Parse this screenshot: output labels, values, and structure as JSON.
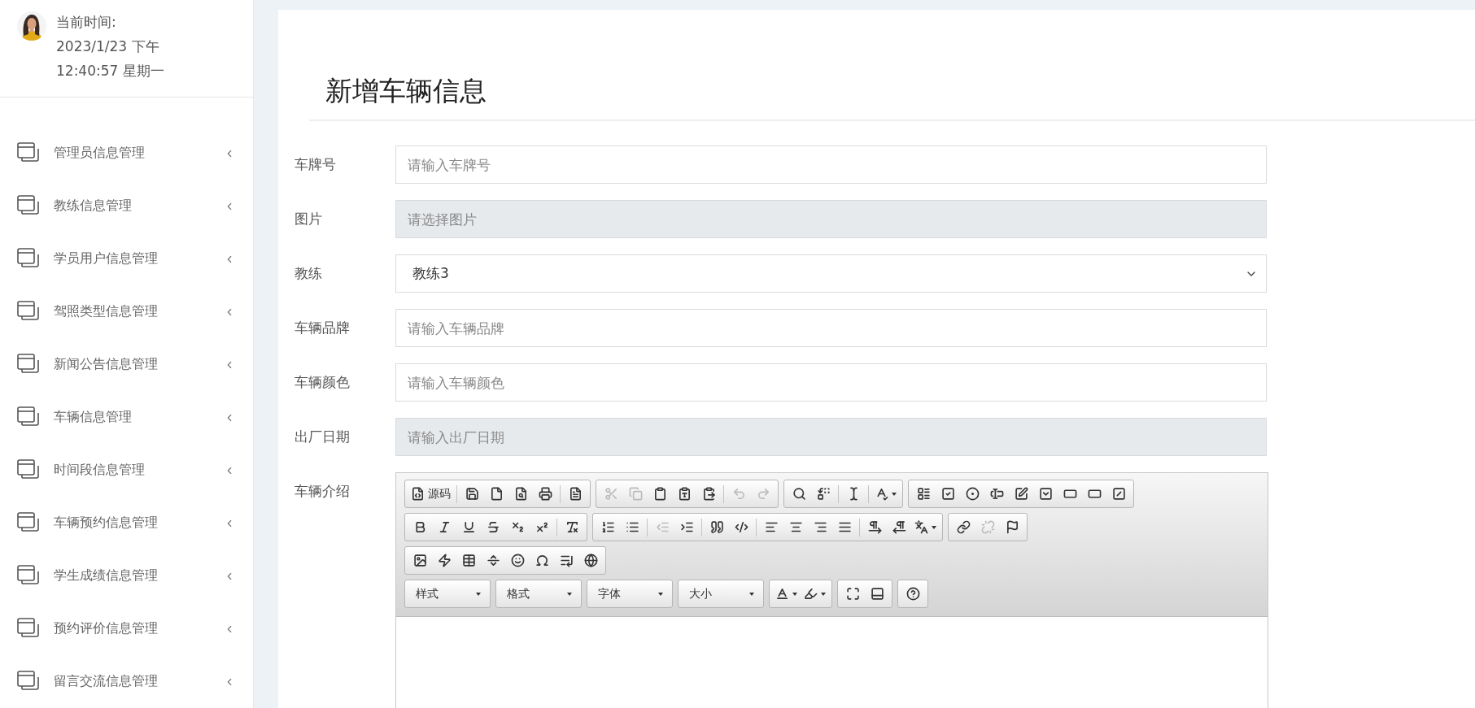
{
  "sidebar": {
    "time_label": "当前时间:",
    "date": "2023/1/23 下午",
    "time": "12:40:57 星期一",
    "items": [
      {
        "label": "管理员信息管理",
        "expanded": false
      },
      {
        "label": "教练信息管理",
        "expanded": false
      },
      {
        "label": "学员用户信息管理",
        "expanded": false
      },
      {
        "label": "驾照类型信息管理",
        "expanded": false
      },
      {
        "label": "新闻公告信息管理",
        "expanded": false
      },
      {
        "label": "车辆信息管理",
        "expanded": false
      },
      {
        "label": "时间段信息管理",
        "expanded": false
      },
      {
        "label": "车辆预约信息管理",
        "expanded": false
      },
      {
        "label": "学生成绩信息管理",
        "expanded": false
      },
      {
        "label": "预约评价信息管理",
        "expanded": false
      },
      {
        "label": "留言交流信息管理",
        "expanded": false
      }
    ]
  },
  "page_title": "新增车辆信息",
  "form": [
    {
      "kind": "input",
      "label": "车牌号",
      "placeholder": "请输入车牌号",
      "readonly": false
    },
    {
      "kind": "input",
      "label": "图片",
      "placeholder": "请选择图片",
      "readonly": true
    },
    {
      "kind": "select",
      "label": "教练",
      "value": "教练3"
    },
    {
      "kind": "input",
      "label": "车辆品牌",
      "placeholder": "请输入车辆品牌",
      "readonly": false
    },
    {
      "kind": "input",
      "label": "车辆颜色",
      "placeholder": "请输入车辆颜色",
      "readonly": false
    },
    {
      "kind": "input",
      "label": "出厂日期",
      "placeholder": "请输入出厂日期",
      "readonly": true
    },
    {
      "kind": "editor",
      "label": "车辆介绍"
    }
  ],
  "editor": {
    "toolbar": [
      [
        [
          {
            "kind": "button",
            "label": "源码",
            "disabled": false
          },
          {
            "kind": "separator"
          },
          {
            "kind": "button",
            "disabled": false
          },
          {
            "kind": "button",
            "disabled": false
          },
          {
            "kind": "button",
            "disabled": false
          },
          {
            "kind": "button",
            "disabled": false
          },
          {
            "kind": "separator"
          },
          {
            "kind": "button",
            "disabled": false
          }
        ],
        [
          {
            "kind": "button",
            "disabled": true
          },
          {
            "kind": "button",
            "disabled": true
          },
          {
            "kind": "button",
            "disabled": false
          },
          {
            "kind": "button",
            "disabled": false
          },
          {
            "kind": "button",
            "disabled": false
          },
          {
            "kind": "separator"
          },
          {
            "kind": "button",
            "disabled": true
          },
          {
            "kind": "button",
            "disabled": true
          }
        ],
        [
          {
            "kind": "button",
            "disabled": false
          },
          {
            "kind": "button",
            "disabled": false
          },
          {
            "kind": "separator"
          },
          {
            "kind": "button",
            "disabled": false
          },
          {
            "kind": "separator"
          },
          {
            "kind": "button",
            "disabled": false,
            "dropdown": true
          }
        ],
        [
          {
            "kind": "button",
            "disabled": false
          },
          {
            "kind": "button",
            "disabled": false
          },
          {
            "kind": "button",
            "disabled": false
          },
          {
            "kind": "button",
            "disabled": false
          },
          {
            "kind": "button",
            "disabled": false
          },
          {
            "kind": "button",
            "disabled": false
          },
          {
            "kind": "button",
            "disabled": false
          },
          {
            "kind": "button",
            "disabled": false
          },
          {
            "kind": "button",
            "disabled": false
          }
        ]
      ],
      [
        [
          {
            "kind": "button",
            "disabled": false
          },
          {
            "kind": "button",
            "disabled": false
          },
          {
            "kind": "button",
            "disabled": false
          },
          {
            "kind": "button",
            "disabled": false
          },
          {
            "kind": "button",
            "disabled": false
          },
          {
            "kind": "button",
            "disabled": false
          },
          {
            "kind": "separator"
          },
          {
            "kind": "button",
            "disabled": false
          }
        ],
        [
          {
            "kind": "button",
            "disabled": false
          },
          {
            "kind": "button",
            "disabled": false
          },
          {
            "kind": "separator"
          },
          {
            "kind": "button",
            "disabled": true
          },
          {
            "kind": "button",
            "disabled": false
          },
          {
            "kind": "separator"
          },
          {
            "kind": "button",
            "disabled": false
          },
          {
            "kind": "button",
            "disabled": false
          },
          {
            "kind": "separator"
          },
          {
            "kind": "button",
            "disabled": false
          },
          {
            "kind": "button",
            "disabled": false
          },
          {
            "kind": "button",
            "disabled": false
          },
          {
            "kind": "button",
            "disabled": false
          },
          {
            "kind": "separator"
          },
          {
            "kind": "button",
            "disabled": false
          },
          {
            "kind": "button",
            "disabled": false
          },
          {
            "kind": "button",
            "disabled": false,
            "dropdown": true
          }
        ],
        [
          {
            "kind": "button",
            "disabled": false
          },
          {
            "kind": "button",
            "disabled": true
          },
          {
            "kind": "button",
            "disabled": false
          }
        ]
      ],
      [
        [
          {
            "kind": "button",
            "disabled": false
          },
          {
            "kind": "button",
            "disabled": false
          },
          {
            "kind": "button",
            "disabled": false
          },
          {
            "kind": "button",
            "disabled": false
          },
          {
            "kind": "button",
            "disabled": false
          },
          {
            "kind": "button",
            "disabled": false
          },
          {
            "kind": "button",
            "disabled": false
          },
          {
            "kind": "button",
            "disabled": false
          }
        ]
      ],
      [
        [
          {
            "kind": "combo",
            "label": "样式"
          }
        ],
        [
          {
            "kind": "combo",
            "label": "格式"
          }
        ],
        [
          {
            "kind": "combo",
            "label": "字体"
          }
        ],
        [
          {
            "kind": "combo",
            "label": "大小"
          }
        ],
        [
          {
            "kind": "button",
            "disabled": false,
            "dropdown": true
          },
          {
            "kind": "button",
            "disabled": false,
            "dropdown": true
          }
        ],
        [
          {
            "kind": "button",
            "disabled": false
          },
          {
            "kind": "button",
            "disabled": false
          }
        ],
        [
          {
            "kind": "button",
            "disabled": false
          }
        ]
      ]
    ]
  }
}
